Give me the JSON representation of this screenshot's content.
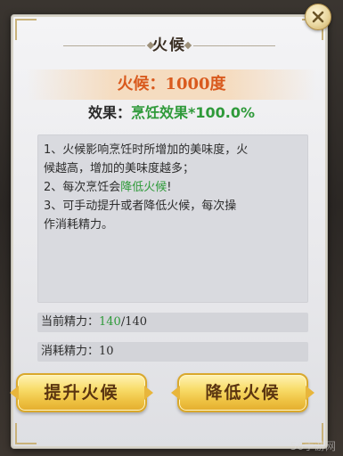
{
  "dialog": {
    "title": "火候",
    "heat": "火候：1000度",
    "effect_label": "效果：",
    "effect_value": "烹饪效果*100.0%"
  },
  "description": {
    "line1": "1、火候影响烹饪时所增加的美味度，火",
    "line2": "候越高，增加的美味度越多；",
    "line3_prefix": "2、每次烹饪会",
    "line3_highlight": "降低火候",
    "line3_suffix": "!",
    "line4": "3、可手动提升或者降低火候，每次操",
    "line5": "作消耗精力。"
  },
  "stats": {
    "current_label": "当前精力：",
    "current_value": "140",
    "current_max": "/140",
    "cost_label": "消耗精力：",
    "cost_value": "10"
  },
  "buttons": {
    "raise": "提升火候",
    "lower": "降低火候"
  },
  "close_icon": "close-x-icon",
  "watermark": "56手游网",
  "colors": {
    "heat": "#d95a1e",
    "effect": "#2f9a3a",
    "button_gold": "#f8dc6a"
  }
}
